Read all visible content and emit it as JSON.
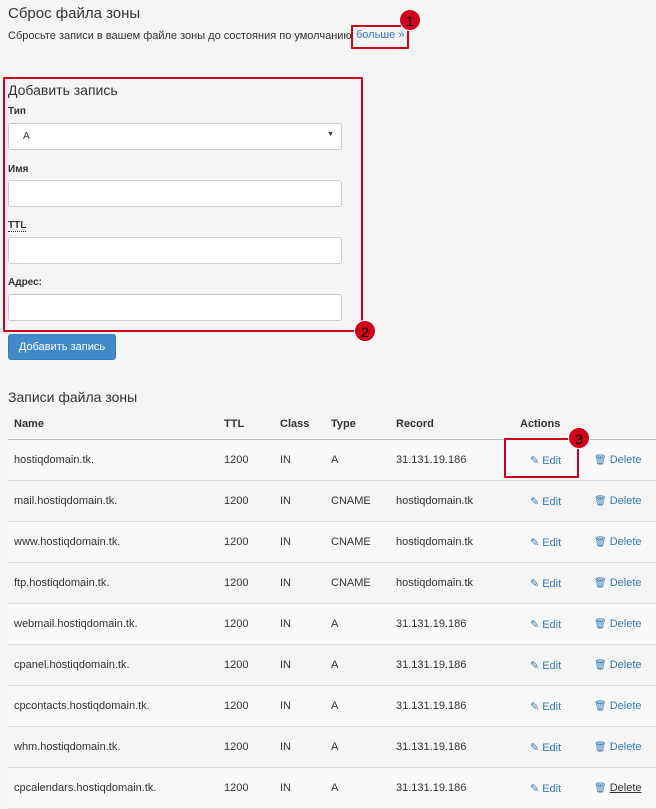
{
  "reset": {
    "title": "Сброс файла зоны",
    "description": "Сбросьте записи в вашем файле зоны до состояния по умолчанию",
    "more_link": "больше »"
  },
  "add_form": {
    "title": "Добавить запись",
    "type_label": "Тип",
    "type_value": "A",
    "name_label": "Имя",
    "ttl_label": "TTL",
    "address_label": "Адрес:",
    "submit_label": "Добавить запись"
  },
  "annotations": [
    "1",
    "2",
    "3"
  ],
  "records": {
    "title": "Записи файла зоны",
    "columns": [
      "Name",
      "TTL",
      "Class",
      "Type",
      "Record",
      "Actions"
    ],
    "edit_label": "Edit",
    "delete_label": "Delete",
    "rows": [
      {
        "name": "hostiqdomain.tk.",
        "ttl": "1200",
        "class": "IN",
        "type": "A",
        "record": "31.131.19.186"
      },
      {
        "name": "mail.hostiqdomain.tk.",
        "ttl": "1200",
        "class": "IN",
        "type": "CNAME",
        "record": "hostiqdomain.tk"
      },
      {
        "name": "www.hostiqdomain.tk.",
        "ttl": "1200",
        "class": "IN",
        "type": "CNAME",
        "record": "hostiqdomain.tk"
      },
      {
        "name": "ftp.hostiqdomain.tk.",
        "ttl": "1200",
        "class": "IN",
        "type": "CNAME",
        "record": "hostiqdomain.tk"
      },
      {
        "name": "webmail.hostiqdomain.tk.",
        "ttl": "1200",
        "class": "IN",
        "type": "A",
        "record": "31.131.19.186"
      },
      {
        "name": "cpanel.hostiqdomain.tk.",
        "ttl": "1200",
        "class": "IN",
        "type": "A",
        "record": "31.131.19.186"
      },
      {
        "name": "cpcontacts.hostiqdomain.tk.",
        "ttl": "1200",
        "class": "IN",
        "type": "A",
        "record": "31.131.19.186"
      },
      {
        "name": "whm.hostiqdomain.tk.",
        "ttl": "1200",
        "class": "IN",
        "type": "A",
        "record": "31.131.19.186"
      },
      {
        "name": "cpcalendars.hostiqdomain.tk.",
        "ttl": "1200",
        "class": "IN",
        "type": "A",
        "record": "31.131.19.186"
      }
    ]
  },
  "icons": {
    "edit": "pencil-icon",
    "delete": "trash-icon",
    "select": "caret-down-icon"
  },
  "colors": {
    "link": "#337ab7",
    "primary_button": "#428bca",
    "callout": "#d0021b"
  }
}
